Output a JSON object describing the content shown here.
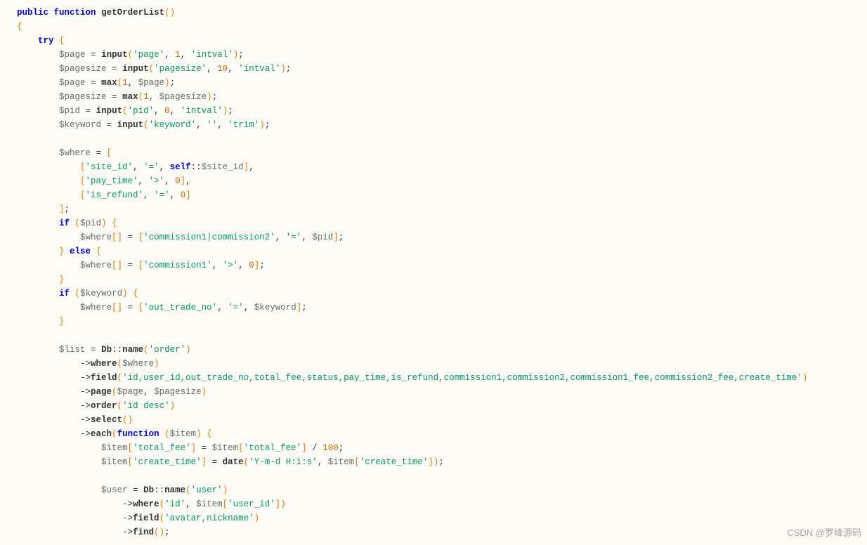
{
  "watermark": "CSDN @罗峰源码",
  "code": {
    "access": "public",
    "keyword_function": "function",
    "method_name": "getOrderList",
    "try_kw": "try",
    "if_kw": "if",
    "else_kw": "else",
    "self_kw": "self",
    "vars": {
      "page": "$page",
      "pagesize": "$pagesize",
      "pid": "$pid",
      "keyword": "$keyword",
      "where": "$where",
      "site_id": "$site_id",
      "list": "$list",
      "item": "$item",
      "user": "$user"
    },
    "funcs": {
      "input": "input",
      "max": "max",
      "Db": "Db",
      "name": "name",
      "where": "where",
      "field": "field",
      "page": "page",
      "order": "order",
      "select": "select",
      "each": "each",
      "date": "date",
      "find": "find"
    },
    "strings": {
      "page": "'page'",
      "intval": "'intval'",
      "pagesize": "'pagesize'",
      "pid": "'pid'",
      "keyword": "'keyword'",
      "trim": "'trim'",
      "empty": "''",
      "site_id": "'site_id'",
      "eq": "'='",
      "pay_time": "'pay_time'",
      "gt": "'>'",
      "is_refund": "'is_refund'",
      "comm_or": "'commission1|commission2'",
      "comm1": "'commission1'",
      "out_trade_no": "'out_trade_no'",
      "order": "'order'",
      "field_list": "'id,user_id,out_trade_no,total_fee,status,pay_time,is_refund,commission1,commission2,commission1_fee,commission2_fee,create_time'",
      "id_desc": "'id desc'",
      "total_fee": "'total_fee'",
      "create_time": "'create_time'",
      "date_fmt": "'Y-m-d H:i:s'",
      "user": "'user'",
      "id": "'id'",
      "user_id": "'user_id'",
      "avatar_nick": "'avatar,nickname'"
    },
    "nums": {
      "one": "1",
      "ten": "10",
      "zero": "0",
      "hundred": "100"
    }
  }
}
